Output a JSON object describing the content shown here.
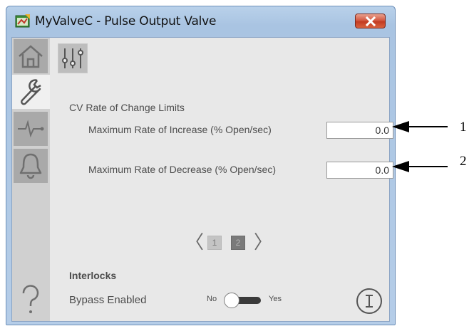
{
  "window": {
    "title": "MyValveC - Pulse Output Valve",
    "close_icon": "close-x-icon",
    "app_icon": "faceplate-app-icon"
  },
  "nav": {
    "tabs": [
      {
        "icon": "home-icon"
      },
      {
        "icon": "wrench-icon",
        "active": true
      },
      {
        "icon": "trend-icon"
      },
      {
        "icon": "bell-icon"
      }
    ],
    "help_icon": "help-question-icon"
  },
  "settings": {
    "tab_icon": "sliders-icon",
    "section_title": "CV Rate of Change Limits",
    "rows": [
      {
        "label": "Maximum Rate of Increase (% Open/sec)",
        "value": "0.0"
      },
      {
        "label": "Maximum Rate of Decrease (% Open/sec)",
        "value": "0.0"
      }
    ]
  },
  "pager": {
    "prev": "〈",
    "next": "〉",
    "pages": [
      "1",
      "2"
    ],
    "current_page": 2
  },
  "interlocks": {
    "title": "Interlocks",
    "bypass_label": "Bypass Enabled",
    "toggle_no": "No",
    "toggle_yes": "Yes",
    "bypass_on": false,
    "info_icon": "info-circle-icon"
  },
  "callouts": [
    "1",
    "2"
  ]
}
